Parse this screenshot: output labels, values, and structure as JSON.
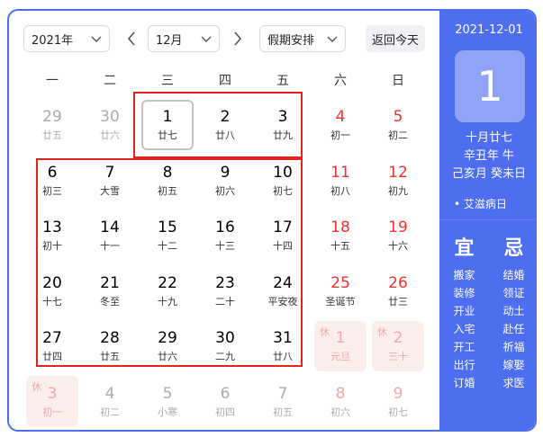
{
  "toolbar": {
    "year": "2021年",
    "month": "12月",
    "holiday": "假期安排",
    "today": "返回今天"
  },
  "weekdays": [
    "一",
    "二",
    "三",
    "四",
    "五",
    "六",
    "日"
  ],
  "days": [
    {
      "n": "29",
      "l": "廿五",
      "out": true
    },
    {
      "n": "30",
      "l": "廿六",
      "out": true
    },
    {
      "n": "1",
      "l": "廿七",
      "selected": true
    },
    {
      "n": "2",
      "l": "廿八"
    },
    {
      "n": "3",
      "l": "廿九"
    },
    {
      "n": "4",
      "l": "初一",
      "weekend": true
    },
    {
      "n": "5",
      "l": "初二",
      "weekend": true
    },
    {
      "n": "6",
      "l": "初三"
    },
    {
      "n": "7",
      "l": "大雪"
    },
    {
      "n": "8",
      "l": "初五"
    },
    {
      "n": "9",
      "l": "初六"
    },
    {
      "n": "10",
      "l": "初七"
    },
    {
      "n": "11",
      "l": "初八",
      "weekend": true
    },
    {
      "n": "12",
      "l": "初九",
      "weekend": true
    },
    {
      "n": "13",
      "l": "初十"
    },
    {
      "n": "14",
      "l": "十一"
    },
    {
      "n": "15",
      "l": "十二"
    },
    {
      "n": "16",
      "l": "十三"
    },
    {
      "n": "17",
      "l": "十四"
    },
    {
      "n": "18",
      "l": "十五",
      "weekend": true
    },
    {
      "n": "19",
      "l": "十六",
      "weekend": true
    },
    {
      "n": "20",
      "l": "十七"
    },
    {
      "n": "21",
      "l": "冬至"
    },
    {
      "n": "22",
      "l": "十九"
    },
    {
      "n": "23",
      "l": "二十"
    },
    {
      "n": "24",
      "l": "平安夜"
    },
    {
      "n": "25",
      "l": "圣诞节",
      "weekend": true
    },
    {
      "n": "26",
      "l": "廿三",
      "weekend": true
    },
    {
      "n": "27",
      "l": "廿四"
    },
    {
      "n": "28",
      "l": "廿五"
    },
    {
      "n": "29",
      "l": "廿六"
    },
    {
      "n": "30",
      "l": "二九"
    },
    {
      "n": "31",
      "l": "廿八"
    },
    {
      "n": "1",
      "l": "元旦",
      "rest": true,
      "tag": "休"
    },
    {
      "n": "2",
      "l": "三十",
      "rest": true,
      "tag": "休"
    },
    {
      "n": "3",
      "l": "初一",
      "rest": true,
      "tag": "休"
    },
    {
      "n": "4",
      "l": "初二",
      "out": true
    },
    {
      "n": "5",
      "l": "小寒",
      "out": true
    },
    {
      "n": "6",
      "l": "初四",
      "out": true
    },
    {
      "n": "7",
      "l": "初五",
      "out": true
    },
    {
      "n": "8",
      "l": "初六",
      "out": true,
      "weekend": true
    },
    {
      "n": "9",
      "l": "初七",
      "out": true,
      "weekend": true
    }
  ],
  "side": {
    "date": "2021-12-01",
    "day": "1",
    "lunar1": "十月廿七",
    "lunar2": "辛丑年 牛",
    "lunar3": "己亥月 癸未日",
    "festival": "• 艾滋病日",
    "yi_label": "宜",
    "ji_label": "忌",
    "yi": [
      "搬家",
      "装修",
      "开业",
      "入宅",
      "开工",
      "出行",
      "订婚"
    ],
    "ji": [
      "结婚",
      "领证",
      "动土",
      "赴任",
      "祈福",
      "嫁娶",
      "求医"
    ]
  },
  "colors": {
    "accent": "#4e6ef2",
    "weekend": "#f73131",
    "highlight": "#e2231a"
  }
}
